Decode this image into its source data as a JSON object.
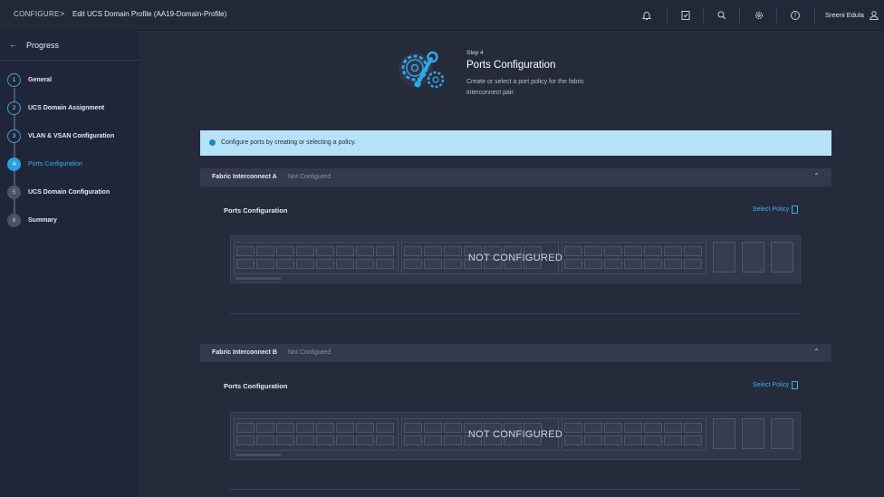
{
  "header": {
    "breadcrumb_root": "CONFIGURE",
    "breadcrumb_sep": ">",
    "page_title": "Edit UCS Domain Profile (AA19-Domain-Profile)",
    "user_name": "Sreeni Edula"
  },
  "sidebar": {
    "title": "Progress",
    "steps": [
      {
        "num": "1",
        "label": "General"
      },
      {
        "num": "2",
        "label": "UCS Domain Assignment"
      },
      {
        "num": "3",
        "label": "VLAN & VSAN Configuration"
      },
      {
        "num": "4",
        "label": "Ports Configuration"
      },
      {
        "num": "5",
        "label": "UCS Domain Configuration"
      },
      {
        "num": "6",
        "label": "Summary"
      }
    ]
  },
  "main": {
    "step_tag": "Step 4",
    "step_title": "Ports Configuration",
    "step_desc": "Create or select a port policy for the fabric interconnect pair.",
    "banner": "Configure ports by creating or selecting a policy.",
    "fabric_a": {
      "name": "Fabric Interconnect A",
      "status": "Not Configured",
      "section_label": "Ports Configuration",
      "select_policy": "Select Policy",
      "overlay": "NOT CONFIGURED"
    },
    "fabric_b": {
      "name": "Fabric Interconnect B",
      "status": "Not Configured",
      "section_label": "Ports Configuration",
      "select_policy": "Select Policy",
      "overlay": "NOT CONFIGURED"
    }
  },
  "colors": {
    "accent": "#2aa0de",
    "banner_bg": "#b6e2f7",
    "background": "#252b3b"
  }
}
